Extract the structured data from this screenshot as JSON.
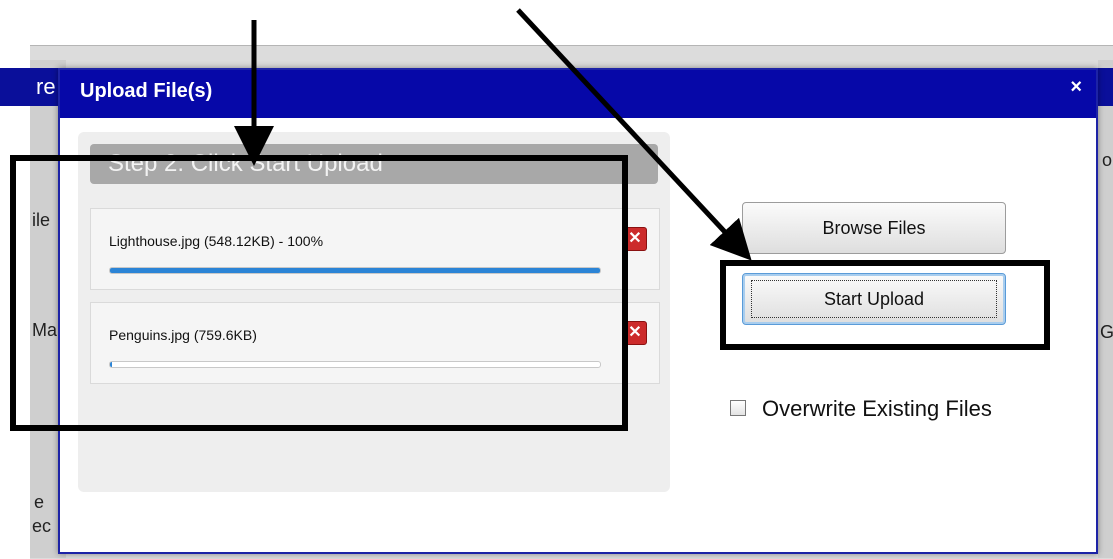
{
  "background": {
    "fragments": [
      "re",
      "ile",
      "Ma",
      "e",
      "ec",
      "o",
      "G"
    ]
  },
  "modal": {
    "title": "Upload File(s)",
    "close_glyph": "×",
    "step_header": "Step 2: Click Start Upload",
    "files": [
      {
        "label": "Lighthouse.jpg (548.12KB) - 100%",
        "progress": 1.0
      },
      {
        "label": "Penguins.jpg (759.6KB)",
        "progress": 0.005
      }
    ],
    "remove_glyph": "✕",
    "browse_label": "Browse Files",
    "start_label": "Start Upload",
    "overwrite_label": "Overwrite Existing Files",
    "overwrite_checked": false
  },
  "colors": {
    "header_blue": "#0608a8",
    "progress_blue": "#2b84d6",
    "remove_red": "#cc2b2b"
  }
}
